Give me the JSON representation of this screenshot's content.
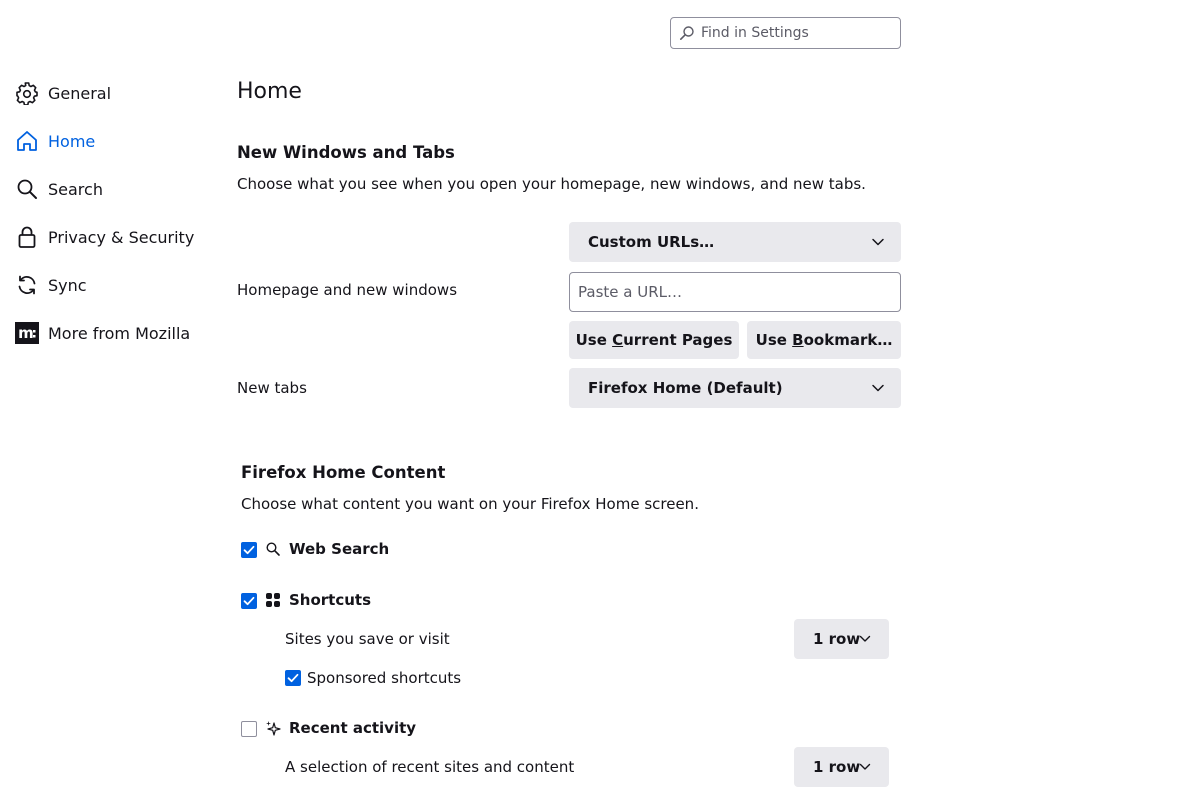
{
  "search": {
    "placeholder": "Find in Settings"
  },
  "sidebar": {
    "items": [
      {
        "label": "General",
        "icon": "gear-icon"
      },
      {
        "label": "Home",
        "icon": "home-icon",
        "active": true
      },
      {
        "label": "Search",
        "icon": "search-icon"
      },
      {
        "label": "Privacy & Security",
        "icon": "lock-icon"
      },
      {
        "label": "Sync",
        "icon": "sync-icon"
      },
      {
        "label": "More from Mozilla",
        "icon": "mozilla-icon"
      }
    ]
  },
  "page": {
    "title": "Home"
  },
  "new_windows": {
    "heading": "New Windows and Tabs",
    "description": "Choose what you see when you open your homepage, new windows, and new tabs.",
    "homepage_label": "Homepage and new windows",
    "homepage_select": "Custom URLs…",
    "url_placeholder": "Paste a URL…",
    "use_current_prefix": "Use ",
    "use_current_key": "C",
    "use_current_suffix": "urrent Pages",
    "use_bookmark_prefix": "Use ",
    "use_bookmark_key": "B",
    "use_bookmark_suffix": "ookmark…",
    "newtabs_label": "New tabs",
    "newtabs_select": "Firefox Home (Default)"
  },
  "home_content": {
    "heading": "Firefox Home Content",
    "description": "Choose what content you want on your Firefox Home screen.",
    "web_search": {
      "label": "Web Search",
      "checked": true
    },
    "shortcuts": {
      "label": "Shortcuts",
      "checked": true,
      "sub_label": "Sites you save or visit",
      "rows": "1 row",
      "sponsored_label": "Sponsored shortcuts",
      "sponsored_checked": true
    },
    "recent_activity": {
      "label": "Recent activity",
      "checked": false,
      "sub_label": "A selection of recent sites and content",
      "rows": "1 row"
    }
  },
  "colors": {
    "accent": "#0061e0",
    "button_bg": "#e9e9ed",
    "text": "#15141a",
    "border": "#8f8f9d"
  }
}
